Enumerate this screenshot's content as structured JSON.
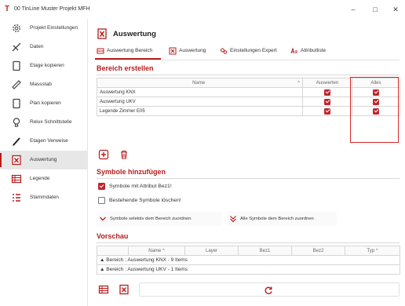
{
  "window": {
    "title": "00 TinLine Muster Projekt MFH",
    "logo": "T",
    "controls": {
      "minimize": "–",
      "maximize": "□",
      "close": "✕"
    }
  },
  "sidebar": {
    "items": [
      {
        "label": "Projekt Einstellungen",
        "icon": "gear-icon"
      },
      {
        "label": "Daten",
        "icon": "pencil-ruler-icon"
      },
      {
        "label": "Etage kopieren",
        "icon": "copy-floor-icon"
      },
      {
        "label": "Massstab",
        "icon": "ruler-icon"
      },
      {
        "label": "Plan kopieren",
        "icon": "copy-plan-icon"
      },
      {
        "label": "Relux Schnittstelle",
        "icon": "lightbulb-icon"
      },
      {
        "label": "Etagen Verweise",
        "icon": "pen-icon"
      },
      {
        "label": "Auswertung",
        "icon": "excel-icon",
        "active": true
      },
      {
        "label": "Legende",
        "icon": "legend-table-icon"
      },
      {
        "label": "Stammdaten",
        "icon": "list-icon"
      }
    ]
  },
  "header": {
    "title": "Auswertung"
  },
  "tabs": [
    {
      "label": "Auswertung Bereich",
      "icon": "area-icon",
      "active": true
    },
    {
      "label": "Auswertung",
      "icon": "excel-icon"
    },
    {
      "label": "Einstellungen Expert",
      "icon": "settings-expert-icon"
    },
    {
      "label": "Attributliste",
      "icon": "attribute-list-icon"
    }
  ],
  "bereich": {
    "title": "Bereich erstellen",
    "columns": {
      "name": "Name",
      "auswerten": "Auswerten",
      "alles": "Alles"
    },
    "rows": [
      {
        "name": "Auswertung KNX",
        "auswerten": true,
        "alles": true
      },
      {
        "name": "Auswertung UKV",
        "auswerten": true,
        "alles": true
      },
      {
        "name": "Legende Zimmer E05",
        "auswerten": true,
        "alles": true
      }
    ]
  },
  "symbole": {
    "title": "Symbole hinzufügen",
    "options": [
      {
        "label": "Symbole mit Attribut Bez1!",
        "checked": true
      },
      {
        "label": "Bestehende Symbole löschen!",
        "checked": false
      }
    ],
    "buttons": {
      "selective": "Symbole selektiv dem Bereich zuordnen",
      "all": "Alle Symbole dem Bereich zuordnen"
    }
  },
  "vorschau": {
    "title": "Vorschau",
    "columns": [
      "Name",
      "Layer",
      "Bez1",
      "Bez2",
      "Typ"
    ],
    "groups": [
      {
        "prefix": "▲",
        "label": "Bereich : Auswertung KNX - 9 Items"
      },
      {
        "prefix": "▲",
        "label": "Bereich : Auswertung UKV - 1 Items"
      }
    ]
  },
  "colors": {
    "accent": "#b71c1c",
    "checkbox": "#c0262d",
    "highlight_box": "#d62828"
  }
}
